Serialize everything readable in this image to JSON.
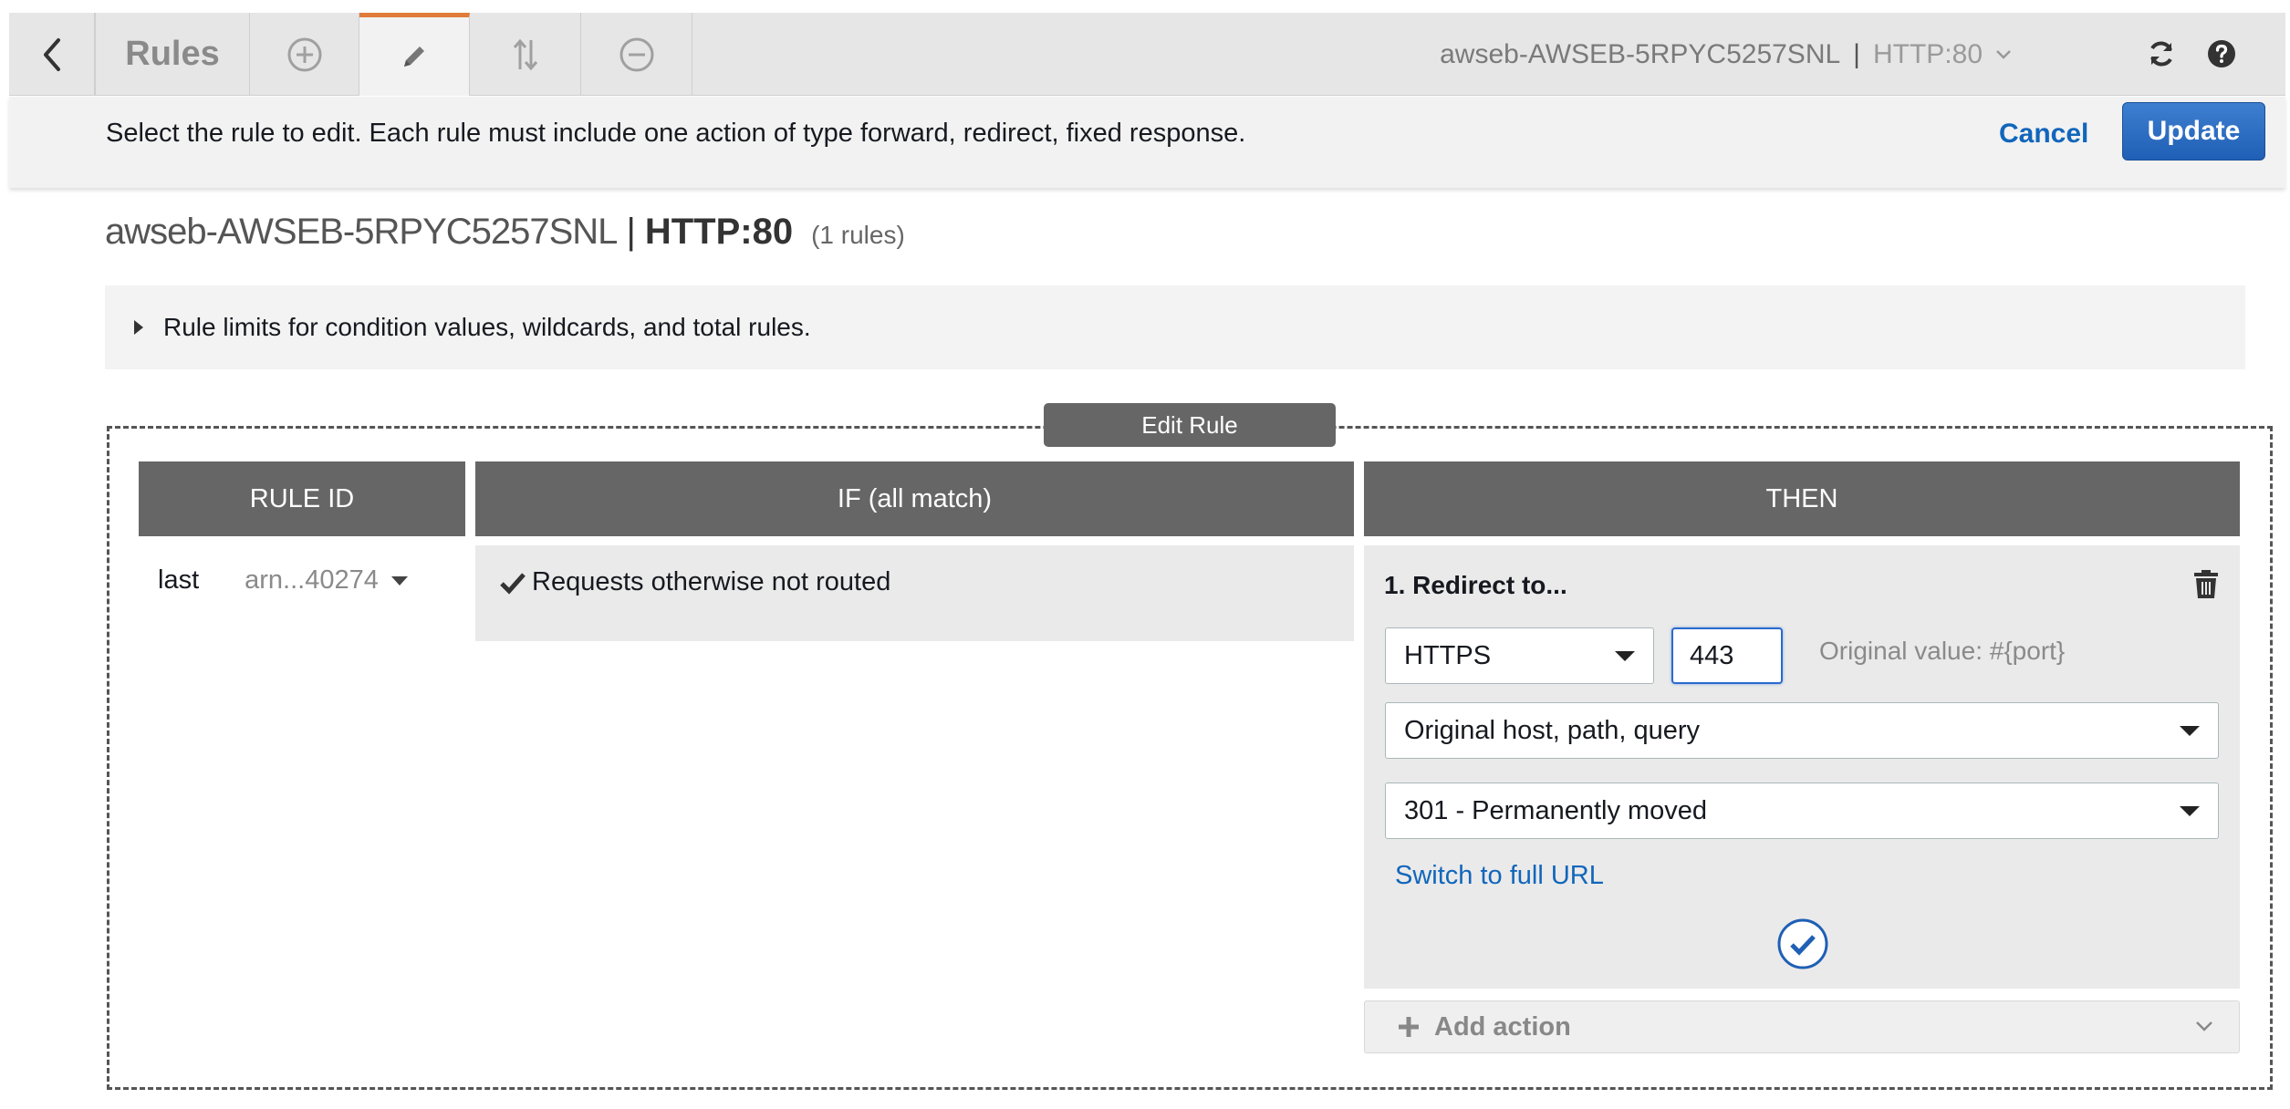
{
  "toolbar": {
    "title": "Rules",
    "listener_name": "awseb-AWSEB-5RPYC5257SNL",
    "listener_sep": "|",
    "listener_port": "HTTP:80",
    "icons": {
      "back": "chevron-left-icon",
      "add": "plus-circle-icon",
      "edit": "pencil-icon",
      "reorder": "sort-arrows-icon",
      "remove": "minus-circle-icon",
      "refresh": "refresh-icon",
      "help": "help-icon"
    }
  },
  "instruction": {
    "text": "Select the rule to edit. Each rule must include one action of type forward, redirect, fixed response.",
    "cancel_label": "Cancel",
    "update_label": "Update"
  },
  "heading": {
    "load_balancer": "awseb-AWSEB-5RPYC5257SNL",
    "sep": "|",
    "protocol": "HTTP:80",
    "count": "(1 rules)"
  },
  "limits": {
    "label": "Rule limits for condition values, wildcards, and total rules."
  },
  "editor": {
    "tab_label": "Edit Rule",
    "columns": [
      "RULE ID",
      "IF (all match)",
      "THEN"
    ],
    "rule": {
      "id_label": "last",
      "arn": "arn...40274"
    },
    "condition": "Requests otherwise not routed",
    "action": {
      "title": "1. Redirect to...",
      "protocol": "HTTPS",
      "port": "443",
      "original_value": "Original value: #{port}",
      "host_option": "Original host, path, query",
      "status_option": "301 - Permanently moved",
      "switch_link": "Switch to full URL"
    },
    "add_action_label": "Add action"
  },
  "colors": {
    "accent_tab": "#e07b39",
    "primary_button": "#1f5fb5",
    "link": "#1166bb",
    "header_bg": "#666666"
  }
}
